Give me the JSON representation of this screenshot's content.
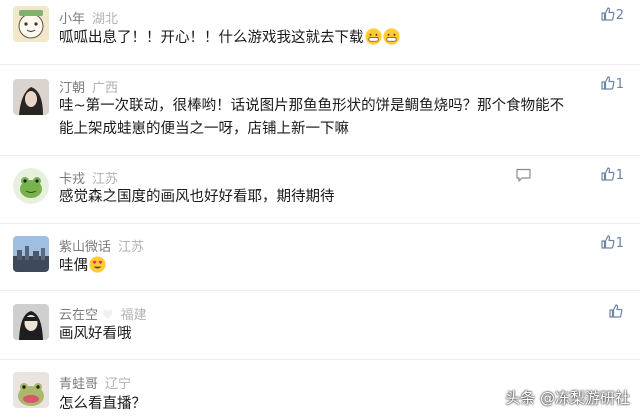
{
  "comments": [
    {
      "name": "小年",
      "location": "湖北",
      "text": "呱呱出息了！！开心！！什么游戏我这就去下载",
      "emojis": [
        "grinning-face",
        "grinning-face"
      ],
      "likes": "2"
    },
    {
      "name": "汀朝",
      "location": "广西",
      "text_lines": [
        "哇~第一次联动，很棒哟！话说图片那鱼鱼形状的饼是鲷鱼烧吗？那个食物能不",
        "能上架成蛙崽的便当之一呀，店铺上新一下嘛"
      ],
      "likes": "1"
    },
    {
      "name": "卡戎",
      "location": "江苏",
      "text": "感觉森之国度的画风也好好看耶，期待期待",
      "likes": "1"
    },
    {
      "name": "紫山微话",
      "location": "江苏",
      "text": "哇偶",
      "emojis": [
        "heart-eyes-face"
      ],
      "likes": "1"
    },
    {
      "name": "云在空",
      "location": "福建",
      "text": "画风好看哦",
      "likes": ""
    },
    {
      "name": "青蛙哥",
      "location": "辽宁",
      "text": "怎么看直播？",
      "likes": ""
    }
  ],
  "watermark": "头条 @冻梨游研社",
  "colors": {
    "name": "#7b7b7b",
    "location": "#b2b2b2",
    "text": "#1a1a1a",
    "action": "#6c85a6",
    "separator": "#ececec"
  }
}
